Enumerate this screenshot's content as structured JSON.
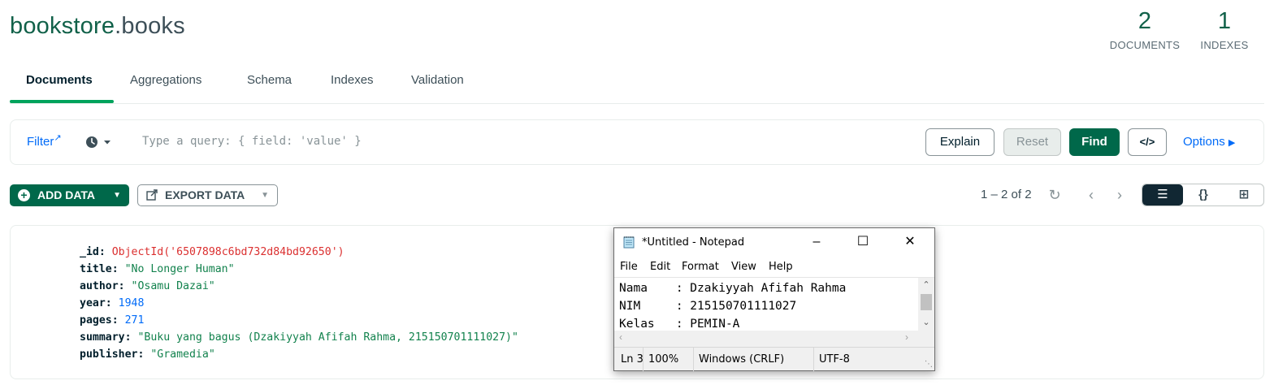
{
  "header": {
    "db": "bookstore",
    "collection": ".books",
    "stats": [
      {
        "value": "2",
        "label": "DOCUMENTS"
      },
      {
        "value": "1",
        "label": "INDEXES"
      }
    ]
  },
  "tabs": [
    {
      "label": "Documents",
      "active": true
    },
    {
      "label": "Aggregations"
    },
    {
      "label": "Schema"
    },
    {
      "label": "Indexes"
    },
    {
      "label": "Validation"
    }
  ],
  "querybar": {
    "filter_label": "Filter",
    "placeholder": "Type a query: { field: 'value' }",
    "explain": "Explain",
    "reset": "Reset",
    "find": "Find",
    "code": "</>",
    "options": "Options"
  },
  "toolbar": {
    "add_data": "ADD DATA",
    "export_data": "EXPORT DATA",
    "pager": "1 – 2 of 2"
  },
  "document": {
    "fields": [
      {
        "key": "_id",
        "prefix": "ObjectId('",
        "value": "6507898c6bd732d84bd92650",
        "suffix": "')",
        "type": "oid"
      },
      {
        "key": "title",
        "value": "\"No Longer Human\"",
        "type": "str"
      },
      {
        "key": "author",
        "value": "\"Osamu Dazai\"",
        "type": "str"
      },
      {
        "key": "year",
        "value": "1948",
        "type": "num"
      },
      {
        "key": "pages",
        "value": "271",
        "type": "num"
      },
      {
        "key": "summary",
        "value": "\"Buku yang bagus (Dzakiyyah Afifah Rahma, 215150701111027)\"",
        "type": "str"
      },
      {
        "key": "publisher",
        "value": "\"Gramedia\"",
        "type": "str"
      }
    ]
  },
  "notepad": {
    "title": "*Untitled - Notepad",
    "menu": [
      "File",
      "Edit",
      "Format",
      "View",
      "Help"
    ],
    "lines": [
      "Nama    : Dzakiyyah Afifah Rahma",
      "NIM     : 215150701111027",
      "Kelas   : PEMIN-A"
    ],
    "status": {
      "position": "Ln 3",
      "zoom": "100%",
      "line_ending": "Windows (CRLF)",
      "encoding": "UTF-8"
    }
  },
  "colors": {
    "brand_green": "#00684a",
    "link_blue": "#016bf8",
    "active_underline": "#00a35c"
  }
}
